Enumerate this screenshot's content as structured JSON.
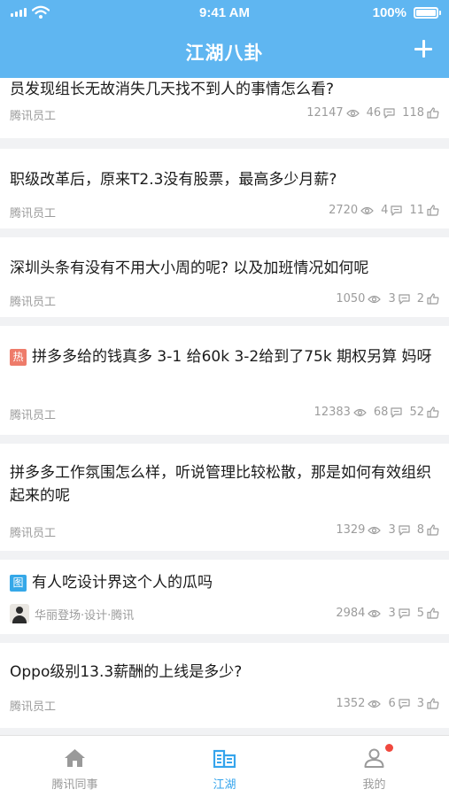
{
  "status_bar": {
    "time": "9:41 AM",
    "battery": "100%"
  },
  "header": {
    "title": "江湖八卦",
    "add_icon": "plus-icon"
  },
  "posts": [
    {
      "title": "员发现组长无故消失几天找不到人的事情怎么看?",
      "author": "腾讯员工",
      "views": "12147",
      "comments": "46",
      "likes": "118"
    },
    {
      "title": "职级改革后，原来T2.3没有股票，最高多少月薪?",
      "author": "腾讯员工",
      "views": "2720",
      "comments": "4",
      "likes": "11"
    },
    {
      "title": "深圳头条有没有不用大小周的呢? 以及加班情况如何呢",
      "author": "腾讯员工",
      "views": "1050",
      "comments": "3",
      "likes": "2"
    },
    {
      "tag": "热",
      "title": "拼多多给的钱真多 3-1 给60k 3-2给到了75k 期权另算 妈呀",
      "author": "腾讯员工",
      "views": "12383",
      "comments": "68",
      "likes": "52"
    },
    {
      "title": "拼多多工作氛围怎么样，听说管理比较松散，那是如何有效组织起来的呢",
      "author": "腾讯员工",
      "views": "1329",
      "comments": "3",
      "likes": "8"
    },
    {
      "tag": "图",
      "title": "有人吃设计界这个人的瓜吗",
      "author": "华丽登场·设计·腾讯",
      "views": "2984",
      "comments": "3",
      "likes": "5"
    },
    {
      "title": "Oppo级别13.3薪酬的上线是多少?",
      "author": "腾讯员工",
      "views": "1352",
      "comments": "6",
      "likes": "3"
    }
  ],
  "tabs": [
    {
      "label": "腾讯同事",
      "icon": "home-icon",
      "active": false
    },
    {
      "label": "江湖",
      "icon": "buildings-icon",
      "active": true
    },
    {
      "label": "我的",
      "icon": "user-icon",
      "active": false,
      "badge": true
    }
  ],
  "colors": {
    "brand": "#5fb6f1",
    "active_tab": "#35a4ec",
    "hot_tag": "#ee7b6a",
    "pic_tag": "#35a8e8",
    "badge": "#f0483e"
  }
}
